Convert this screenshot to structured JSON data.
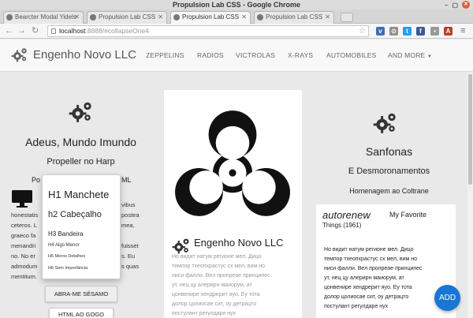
{
  "window": {
    "title": "Propulsion Lab CSS - Google Chrome"
  },
  "tabs": [
    {
      "label": "Bearcter Modal Yidels",
      "active": false
    },
    {
      "label": "Propulsion Lab CSS",
      "active": false
    },
    {
      "label": "Propulsion Lab CSS",
      "active": true
    },
    {
      "label": "Propulsion Lab CSS",
      "active": false
    }
  ],
  "address": {
    "host": "localhost",
    "path": ":8888/#collapseOne4"
  },
  "navbar": {
    "brand": "Engenho Novo LLC",
    "links": [
      "ZEPPELINS",
      "RADIOS",
      "VICTROLAS",
      "X-RAYS",
      "AUTOMOBILES",
      "AND MORE"
    ]
  },
  "col1": {
    "title": "Adeus, Mundo Imundo",
    "subtitle": "Propeller no Harp",
    "trunc_left": "Po",
    "trunc_right": "ML",
    "body_lines": [
      {
        "l": "",
        "r": "vibus"
      },
      {
        "l": "honestatis",
        "r": "postea"
      },
      {
        "l": "ceteros. L",
        "r": "mea,"
      },
      {
        "l": "graeco fa",
        "r": ""
      },
      {
        "l": "menandri",
        "r": "fuisset"
      },
      {
        "l": "no. No er",
        "r": "s. Eu"
      },
      {
        "l": "admodum",
        "r": "s quas"
      },
      {
        "l": "mentitum.",
        "r": ""
      }
    ],
    "button_primary": "ABRA-ME SÉSAMO",
    "button_secondary": "HTML AO GOGO"
  },
  "dropdown": {
    "h1": "H1 Manchete",
    "h2": "h2 Cabeçalho",
    "h3": "H3 Bandeira",
    "h4": "H4 Algo Menor",
    "h5": "H5 Meros Detalhes",
    "h6": "H6 Sem Importância"
  },
  "col2": {
    "heading": "Engenho Novo LLC",
    "body_lines": [
      "Ho видит натум регионе мел. Дицо",
      "темпор тхеопхрастус сх мел, вим но",
      "ниси фалли. Вел пропреае принципес",
      "ут, нец цу алерирн маиорум, ат",
      "цонвенире хендрерит яуо. Еу тота",
      "долор цолиосае сит, оу детрацто",
      "постулант регулдаре нух"
    ]
  },
  "col3": {
    "title": "Sanfonas",
    "subtitle": "E Desmoronamentos",
    "subtitle2": "Homenagem ao Coltrane"
  },
  "card": {
    "title": "autorenew",
    "favorite": "My Favorite",
    "year": "Things (1961)",
    "body_lines": [
      "Но видит натум регионе мел. Дицо",
      "темпор тхеопхрастус сх мел, вим но",
      "ниси фалли. Вел пропреае принципес",
      "ут, нец цу алерирн маиорум, ат",
      "цонвенире хендрерит яуо. Еу тота",
      "долор цолиосае сит, оу детрацто",
      "постулант регулдаре нух"
    ]
  },
  "fab": {
    "label": "ADD"
  },
  "colors": {
    "fab": "#1976d2",
    "background": "#e9e9e9"
  }
}
